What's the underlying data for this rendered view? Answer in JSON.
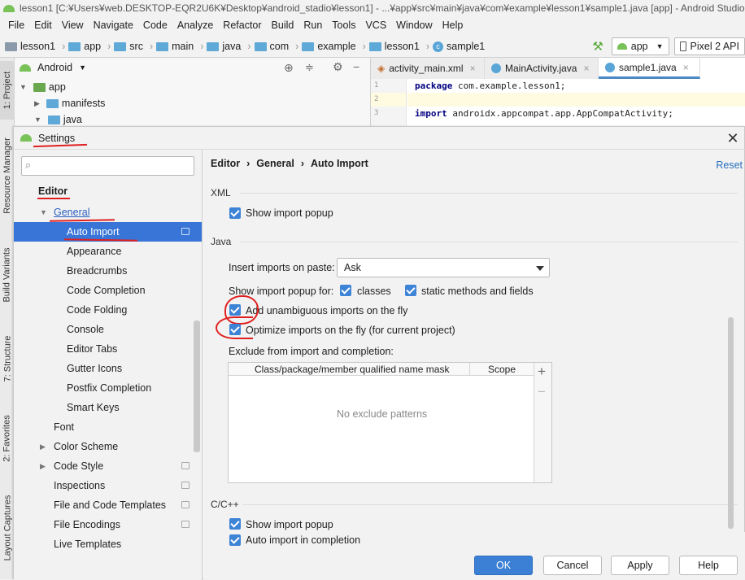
{
  "window": {
    "title": "lesson1 [C:¥Users¥web.DESKTOP-EQR2U6K¥Desktop¥android_stadio¥lesson1] - ...¥app¥src¥main¥java¥com¥example¥lesson1¥sample1.java [app] - Android Studio"
  },
  "menu": [
    "File",
    "Edit",
    "View",
    "Navigate",
    "Code",
    "Analyze",
    "Refactor",
    "Build",
    "Run",
    "Tools",
    "VCS",
    "Window",
    "Help"
  ],
  "breadcrumbs": [
    "lesson1",
    "app",
    "src",
    "main",
    "java",
    "com",
    "example",
    "lesson1",
    "sample1"
  ],
  "toolbar": {
    "config": "app",
    "device": "Pixel 2 API"
  },
  "side_tabs": [
    "1: Project",
    "Resource Manager",
    "Build Variants",
    "7: Structure",
    "2: Favorites",
    "Layout Captures"
  ],
  "project_panel": {
    "view": "Android",
    "tree": [
      "app",
      "manifests",
      "java"
    ]
  },
  "editor": {
    "tabs": [
      "activity_main.xml",
      "MainActivity.java",
      "sample1.java"
    ],
    "lines": [
      {
        "num": "1",
        "kw": "package",
        "rest": " com.example.lesson1;"
      },
      {
        "num": "2",
        "kw": "",
        "rest": ""
      },
      {
        "num": "3",
        "kw": "import",
        "rest": " androidx.appcompat.app.AppCompatActivity;"
      }
    ]
  },
  "settings": {
    "title": "Settings",
    "search_placeholder": "",
    "tree": {
      "editor": "Editor",
      "general": "General",
      "auto_import": "Auto Import",
      "general_children": [
        "Appearance",
        "Breadcrumbs",
        "Code Completion",
        "Code Folding",
        "Console",
        "Editor Tabs",
        "Gutter Icons",
        "Postfix Completion",
        "Smart Keys"
      ],
      "font": "Font",
      "color_scheme": "Color Scheme",
      "code_style": "Code Style",
      "inspections": "Inspections",
      "file_code_templates": "File and Code Templates",
      "file_encodings": "File Encodings",
      "live_templates": "Live Templates"
    },
    "path": [
      "Editor",
      "General",
      "Auto Import"
    ],
    "reset": "Reset",
    "xml": {
      "section": "XML",
      "show_popup": "Show import popup"
    },
    "java": {
      "section": "Java",
      "insert_label": "Insert imports on paste:",
      "insert_value": "Ask",
      "show_popup_for": "Show import popup for:",
      "classes": "classes",
      "static": "static methods and fields",
      "add_unambiguous": "Add unambiguous imports on the fly",
      "optimize": "Optimize imports on the fly (for current project)",
      "exclude_label": "Exclude from import and completion:",
      "col_mask": "Class/package/member qualified name mask",
      "col_scope": "Scope",
      "empty": "No exclude patterns"
    },
    "cpp": {
      "section": "C/C++",
      "show_popup": "Show import popup",
      "auto_complete": "Auto import in completion"
    },
    "buttons": {
      "ok": "OK",
      "cancel": "Cancel",
      "apply": "Apply",
      "help": "Help"
    }
  },
  "colors": {
    "accent": "#3875d7",
    "checkbox": "#3d83d6",
    "annotation": "#e02020",
    "android_green": "#78c257"
  }
}
